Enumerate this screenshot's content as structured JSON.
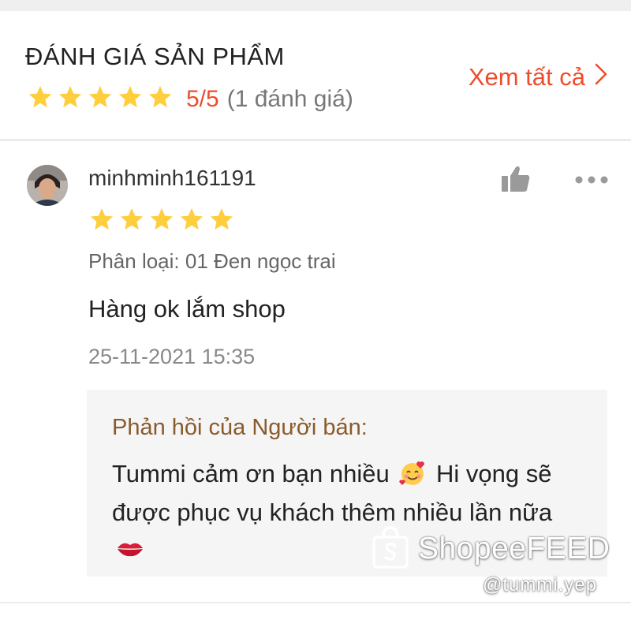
{
  "header": {
    "title": "ĐÁNH GIÁ SẢN PHẨM",
    "rating_score": "5/5",
    "rating_count": "(1 đánh giá)",
    "rating_value": 5,
    "see_all_label": "Xem tất cả"
  },
  "review": {
    "username": "minhminh161191",
    "stars": 5,
    "variation": "Phân loại: 01 Đen ngọc trai",
    "text": "Hàng ok lắm shop",
    "time": "25-11-2021 15:35",
    "reply": {
      "title": "Phản hồi của Người bán:",
      "text_part1": "Tummi cảm ơn bạn nhiều",
      "text_part2": "Hi vọng sẽ được phục vụ khách thêm nhiều lần nữa"
    }
  },
  "watermark": {
    "brand": "ShopeeFEED",
    "handle": "@tummi.yep"
  },
  "icons": {
    "star": "star-icon",
    "chevron": "chevron-right-icon",
    "like": "thumbs-up-icon",
    "more": "more-dots-icon",
    "emoji1": "smiling-face-with-hearts-emoji",
    "emoji2": "kiss-mark-emoji",
    "shopee_bag": "shopping-bag-icon"
  },
  "colors": {
    "accent": "#ee4d2d",
    "star": "#ffce3d",
    "seller_reply_title": "#8a5a2b"
  }
}
